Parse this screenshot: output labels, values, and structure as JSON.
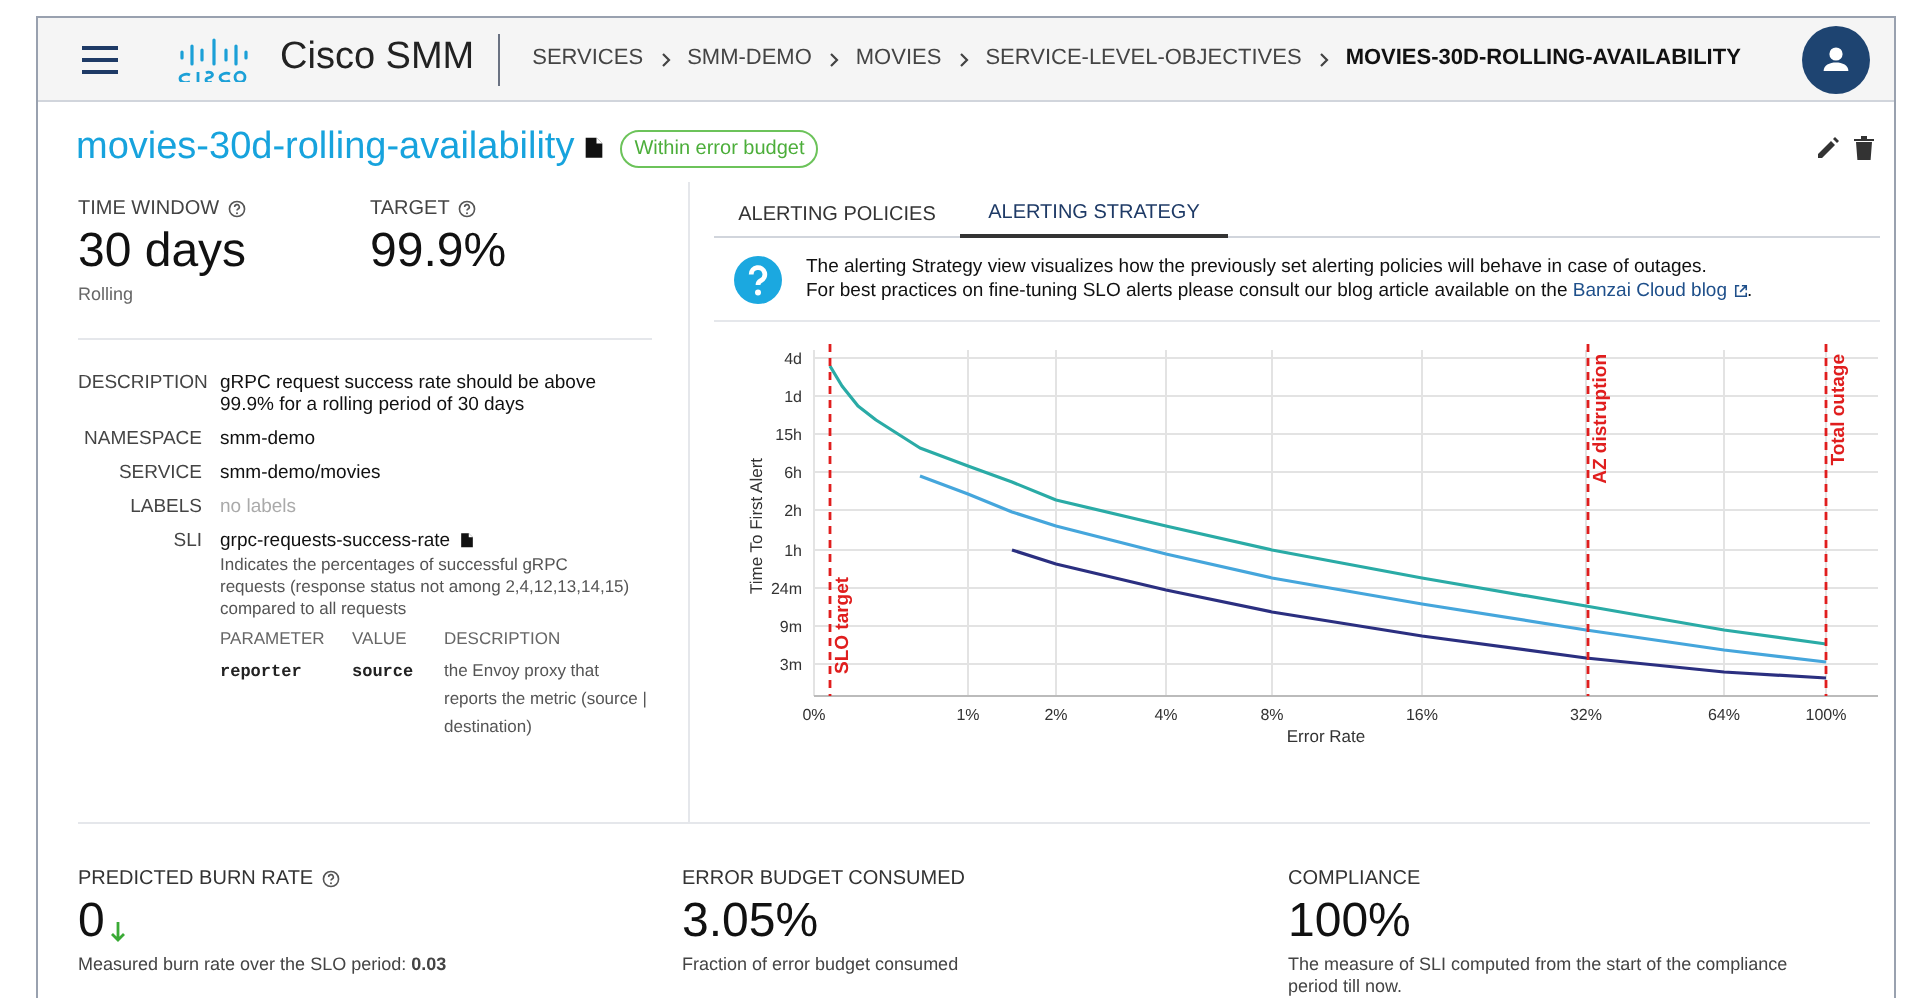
{
  "header": {
    "app_name": "Cisco SMM",
    "breadcrumbs": [
      "SERVICES",
      "SMM-DEMO",
      "MOVIES",
      "SERVICE-LEVEL-OBJECTIVES",
      "MOVIES-30D-ROLLING-AVAILABILITY"
    ]
  },
  "slo": {
    "name": "movies-30d-rolling-availability",
    "status": "Within error budget"
  },
  "summary": [
    {
      "label": "TIME WINDOW",
      "help": true,
      "value": "30 days",
      "note": "Rolling"
    },
    {
      "label": "TARGET",
      "help": true,
      "value": "99.9%"
    }
  ],
  "details": [
    {
      "label": "DESCRIPTION",
      "value": "gRPC request success rate should be above 99.9% for a rolling period of 30 days",
      "kind": "text"
    },
    {
      "label": "NAMESPACE",
      "value": "smm-demo",
      "kind": "text"
    },
    {
      "label": "SERVICE",
      "value": "smm-demo/movies",
      "kind": "text"
    },
    {
      "label": "LABELS",
      "value": "no labels",
      "kind": "empty"
    }
  ],
  "sli": {
    "label": "SLI",
    "name": "grpc-requests-success-rate",
    "description": "Indicates the percentages of successful gRPC requests (response status not among 2,4,12,13,14,15) compared to all requests",
    "columns": [
      "PARAMETER",
      "VALUE",
      "DESCRIPTION"
    ],
    "parameters": [
      {
        "parameter": "reporter",
        "value": "source",
        "description": "the Envoy proxy that reports the metric (source | destination)"
      }
    ]
  },
  "tabs": [
    {
      "label": "ALERTING POLICIES",
      "selected": false
    },
    {
      "label": "ALERTING STRATEGY",
      "selected": true
    }
  ],
  "info": {
    "line_1": "The alerting Strategy view visualizes how the previously set alerting policies will behave in case of outages.",
    "line_2": "For best practices on fine-tuning SLO alerts please consult our blog article available on the",
    "link": "Banzai Cloud blog",
    "end": "."
  },
  "chart": {
    "xlabel": "Error Rate",
    "ylabel": "Time To First Alert",
    "x_ticks": [
      "0%",
      "1%",
      "2%",
      "4%",
      "8%",
      "16%",
      "32%",
      "64%",
      "100%"
    ],
    "y_ticks": [
      "4d",
      "1d",
      "15h",
      "6h",
      "2h",
      "1h",
      "24m",
      "9m",
      "3m"
    ],
    "markers": [
      "SLO target",
      "AZ distruption",
      "Total outage"
    ]
  },
  "metrics": [
    {
      "label": "PREDICTED BURN RATE",
      "help": true,
      "value": "0",
      "trending_down": true,
      "note": "Measured burn rate over the SLO period: **0.03**"
    },
    {
      "label": "ERROR BUDGET CONSUMED",
      "help": false,
      "value": "3.05%",
      "trending_down": false,
      "note": "Fraction of error budget consumed"
    },
    {
      "label": "COMPLIANCE",
      "help": false,
      "value": "100%",
      "trending_down": false,
      "note": "The measure of SLI computed from the start of the compliance period till now."
    }
  ]
}
